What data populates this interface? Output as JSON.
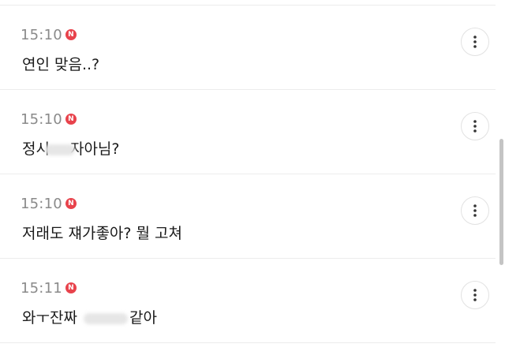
{
  "comments": [
    {
      "time": "15:10",
      "badge": "N",
      "text": "연인 맞음..?"
    },
    {
      "time": "15:10",
      "badge": "N",
      "text_before": "정시",
      "text_after": "자아님?"
    },
    {
      "time": "15:10",
      "badge": "N",
      "text": "저래도 쟤가좋아? 뭘 고쳐"
    },
    {
      "time": "15:11",
      "badge": "N",
      "text_before": "와ㅜ잔짜 ",
      "text_after": "같아"
    }
  ],
  "icons": {
    "new_badge": "new-badge-icon",
    "more": "more-vertical-icon"
  },
  "colors": {
    "badge": "#e8434c",
    "time": "#8a8a8a",
    "text": "#1a1a1a",
    "divider": "#ececec"
  }
}
